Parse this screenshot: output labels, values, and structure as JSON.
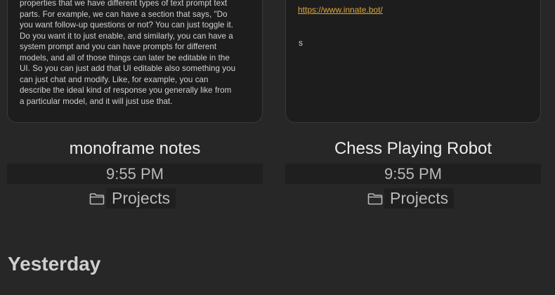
{
  "notes": [
    {
      "title": "monoframe notes",
      "time": "9:55 PM",
      "folder": "Projects",
      "preview_lines": [
        "properties that we have different types of text prompt text",
        "parts. For example, we can have a section that says, \"Do",
        "you want follow-up questions or not? You can just toggle it.",
        "Do you want it to just enable, and similarly, you can have a",
        "system prompt and you can have prompts for different",
        "models, and all of those things can later be editable in the",
        "UI. So you can just add that UI editable also something you",
        "can just chat and modify. Like, for example, you can",
        "describe the ideal kind of response you generally like from",
        "a particular model, and it will just use that."
      ]
    },
    {
      "title": "Chess Playing Robot",
      "time": "9:55 PM",
      "folder": "Projects",
      "preview_link": "https://www.innate.bot/",
      "preview_extra": "s"
    }
  ],
  "sections": {
    "yesterday": "Yesterday"
  },
  "icons": {
    "folder": "folder-icon"
  },
  "colors": {
    "background": "#272727",
    "card": "#1d1d1d",
    "link": "#e0a93b"
  }
}
